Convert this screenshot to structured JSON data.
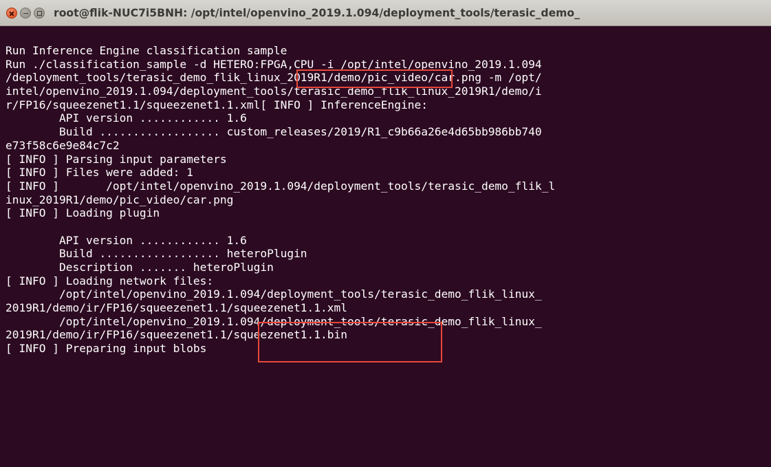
{
  "window": {
    "title": "root@flik-NUC7i5BNH: /opt/intel/openvino_2019.1.094/deployment_tools/terasic_demo_",
    "buttons": {
      "close_icon": "close-icon",
      "minimize_icon": "minimize-icon",
      "maximize_icon": "maximize-icon"
    }
  },
  "colors": {
    "terminal_background": "#2c0a21",
    "terminal_text": "#ffffff",
    "highlight_box": "#e8483a"
  },
  "terminal": {
    "lines": [
      "Run Inference Engine classification sample",
      "Run ./classification_sample -d HETERO:FPGA,CPU -i /opt/intel/openvino_2019.1.094",
      "/deployment_tools/terasic_demo_flik_linux_2019R1/demo/pic_video/car.png -m /opt/",
      "intel/openvino_2019.1.094/deployment_tools/terasic_demo_flik_linux_2019R1/demo/i",
      "r/FP16/squeezenet1.1/squeezenet1.1.xml[ INFO ] InferenceEngine:",
      "        API version ............ 1.6",
      "        Build .................. custom_releases/2019/R1_c9b66a26e4d65bb986bb740",
      "e73f58c6e9e84c7c2",
      "[ INFO ] Parsing input parameters",
      "[ INFO ] Files were added: 1",
      "[ INFO ]       /opt/intel/openvino_2019.1.094/deployment_tools/terasic_demo_flik_l",
      "inux_2019R1/demo/pic_video/car.png",
      "[ INFO ] Loading plugin",
      "",
      "        API version ............ 1.6",
      "        Build .................. heteroPlugin",
      "        Description ....... heteroPlugin",
      "[ INFO ] Loading network files:",
      "        /opt/intel/openvino_2019.1.094/deployment_tools/terasic_demo_flik_linux_",
      "2019R1/demo/ir/FP16/squeezenet1.1/squeezenet1.1.xml",
      "        /opt/intel/openvino_2019.1.094/deployment_tools/terasic_demo_flik_linux_",
      "2019R1/demo/ir/FP16/squeezenet1.1/squeezenet1.1.bin",
      "[ INFO ] Preparing input blobs"
    ]
  }
}
